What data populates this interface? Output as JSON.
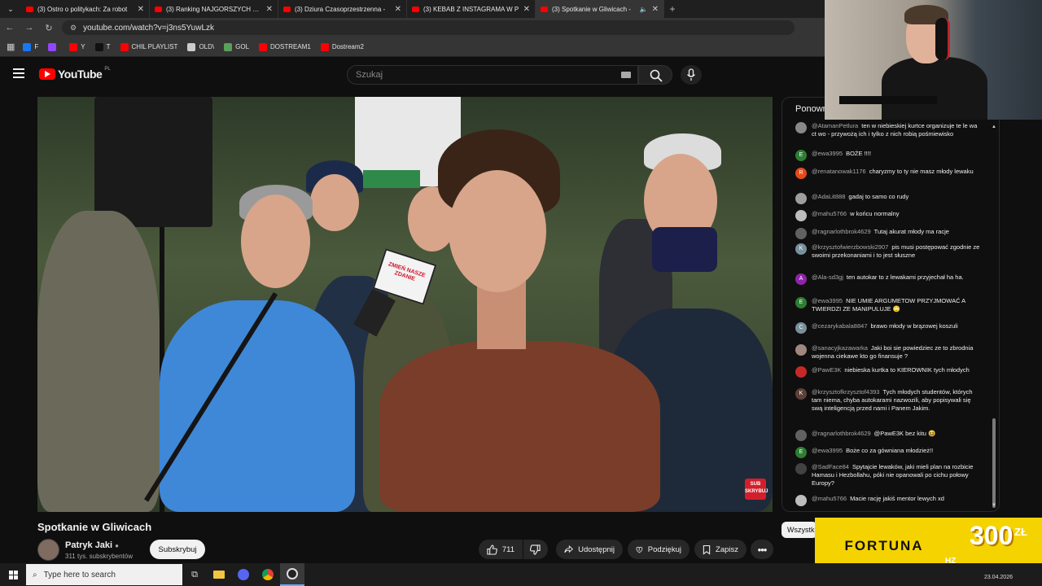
{
  "browser": {
    "tabs": [
      {
        "title": "(3) Ostro o politykach: Za robot",
        "active": false
      },
      {
        "title": "(3) Ranking NAJGORSZYCH pre",
        "active": false
      },
      {
        "title": "(3) Dziura Czasoprzestrzenna -",
        "active": false
      },
      {
        "title": "(3) KEBAB Z INSTAGRAMA W P",
        "active": false
      },
      {
        "title": "(3) Spotkanie w Gliwicach -",
        "active": true
      }
    ],
    "url": "youtube.com/watch?v=j3ns5YuwLzk",
    "bookmarks": [
      {
        "label": "F",
        "color": "#1877f2"
      },
      {
        "label": "",
        "color": "#9146ff"
      },
      {
        "label": "Y",
        "color": "#ff0000"
      },
      {
        "label": "T",
        "color": "#111111"
      },
      {
        "label": "CHIL PLAYLIST",
        "color": "#ff0000"
      },
      {
        "label": "OLD\\",
        "color": "#cccccc"
      },
      {
        "label": "GOL",
        "color": "#5aa05a"
      },
      {
        "label": "DOSTREAM1",
        "color": "#ff0000"
      },
      {
        "label": "Dostream2",
        "color": "#ff0000"
      }
    ]
  },
  "youtube": {
    "logo_text": "YouTube",
    "logo_region": "PL",
    "search_placeholder": "Szukaj"
  },
  "video": {
    "mic_label": "ZMIEŃ NASZE ZDANIE",
    "corner_logo": "SUB SKRYBUJ",
    "title": "Spotkanie w Gliwicach",
    "channel_name": "Patryk Jaki",
    "subscribers": "311 tys. subskrybentów",
    "subscribe_label": "Subskrybuj",
    "likes": "711",
    "share_label": "Udostępnij",
    "thanks_label": "Podziękuj",
    "save_label": "Zapisz"
  },
  "chat": {
    "header": "Ponown",
    "filter_label": "Wszystk",
    "messages": [
      {
        "user": "@AtamanPetlura",
        "text": "ten w niebieskiej kurtce organizuje te le wa ct wo - przywożą ich i tylko z nich robią pośmiewisko",
        "avatar_color": "#888888",
        "initial": ""
      },
      {
        "user": "@ewa3995",
        "text": "BOŻE !!!!",
        "avatar_color": "#2e7d32",
        "initial": "E"
      },
      {
        "user": "@renatanowak1176",
        "text": "charyzmy to ty nie masz młody lewaku",
        "avatar_color": "#e64a19",
        "initial": "R"
      },
      {
        "user": "@AdaLit888",
        "text": "gadaj to samo co rudy",
        "avatar_color": "#9e9e9e",
        "initial": ""
      },
      {
        "user": "@mahu5766",
        "text": "w końcu normalny",
        "avatar_color": "#bdbdbd",
        "initial": ""
      },
      {
        "user": "@ragnarlothbrok4629",
        "text": "Tutaj akurat młody ma racje",
        "avatar_color": "#616161",
        "initial": ""
      },
      {
        "user": "@krzysztofwierzbowski2907",
        "text": "pis musi postępować zgodnie ze swoimi przekonaniami i to jest słuszne",
        "avatar_color": "#78909c",
        "initial": "K"
      },
      {
        "user": "@Ala-sd3gj",
        "text": "ten autokar to z lewakami przyjechał ha ha.",
        "avatar_color": "#8e24aa",
        "initial": "A"
      },
      {
        "user": "@ewa3995",
        "text": "NIE UMIE ARGUMETOW PRZYJMOWAĆ A TWIERDZI ZE MANIPULUJE 🙄",
        "avatar_color": "#2e7d32",
        "initial": "E"
      },
      {
        "user": "@cezarykabala8847",
        "text": "brawo młody w brązowej koszuli",
        "avatar_color": "#78909c",
        "initial": "C"
      },
      {
        "user": "@sanacyjkazawarka",
        "text": "Jaki boi sie powiedziec ze to zbrodnia wojenna ciekawe kto go finansuje ?",
        "avatar_color": "#a1887f",
        "initial": ""
      },
      {
        "user": "@PawE3K",
        "text": "niebieska kurtka to KIEROWNIK tych młodych",
        "avatar_color": "#c62828",
        "initial": ""
      },
      {
        "user": "@krzysztofkrzysztof4393",
        "text": "Tych młodych studentów, których tam niema, chyba autokarami nazwozili, aby popisywali się swą inteligencją przed nami i Panem Jakim.",
        "avatar_color": "#5d4037",
        "initial": "K"
      },
      {
        "user": "@ragnarlothbrok4629",
        "text": "@PawE3K bez kitu 😆",
        "avatar_color": "#616161",
        "initial": ""
      },
      {
        "user": "@ewa3995",
        "text": "Boże co za gówniana młodzież!!",
        "avatar_color": "#2e7d32",
        "initial": "E"
      },
      {
        "user": "@SadFace84",
        "text": "Spytajcie lewaków, jaki mieli plan na rozbicie Hamasu i Hezbollahu, póki nie opanowali po cichu połowy Europy?",
        "avatar_color": "#424242",
        "initial": ""
      },
      {
        "user": "@mahu5766",
        "text": "Macie rację jakiś mentor lewych xd",
        "avatar_color": "#bdbdbd",
        "initial": ""
      }
    ]
  },
  "ad": {
    "brand": "FORTUNA",
    "amount": "300",
    "currency": "ZŁ",
    "suffix": "HZ"
  },
  "taskbar": {
    "search_placeholder": "Type here to search",
    "date": "23.04.2026"
  }
}
